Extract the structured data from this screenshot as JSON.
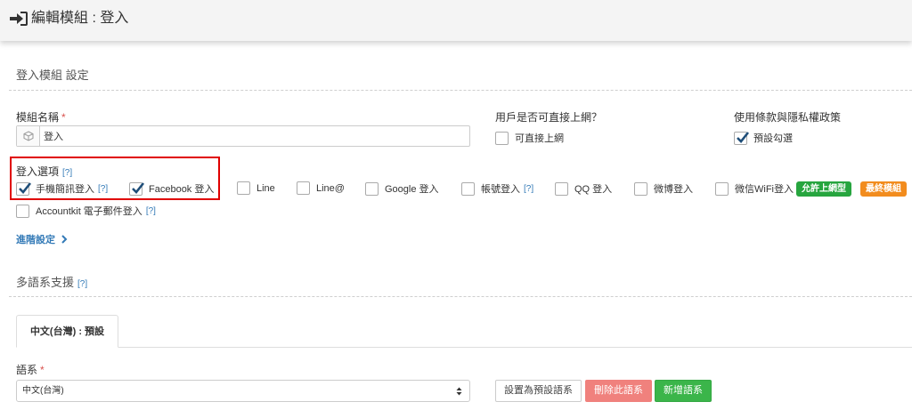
{
  "header": {
    "title": "編輯模組 : 登入",
    "icon": "sign-in-icon"
  },
  "settings": {
    "section_title": "登入模組 設定",
    "module_name": {
      "label": "模組名稱",
      "required": "*",
      "value": "登入",
      "icon": "cube-icon"
    },
    "direct_access": {
      "label": "用戶是否可直接上網？",
      "option": "可直接上網",
      "checked": false
    },
    "terms": {
      "label": "使用條款與隱私權政策",
      "option": "預設勾選",
      "checked": true
    },
    "login_options": {
      "label": "登入選項",
      "help": "[?]",
      "items": [
        {
          "label": "手機簡訊登入",
          "help": "[?]",
          "checked": true
        },
        {
          "label": "Facebook 登入",
          "checked": true
        },
        {
          "label": "Line",
          "checked": false
        },
        {
          "label": "Line@",
          "checked": false
        },
        {
          "label": "Google 登入",
          "checked": false
        },
        {
          "label": "帳號登入",
          "help": "[?]",
          "checked": false
        },
        {
          "label": "QQ 登入",
          "checked": false
        },
        {
          "label": "微博登入",
          "checked": false
        },
        {
          "label": "微信WiFi登入",
          "checked": false
        },
        {
          "label": "Accountkit 電子郵件登入",
          "help": "[?]",
          "checked": false
        }
      ],
      "tags": [
        {
          "label": "允許上網型",
          "color": "#27a53f"
        },
        {
          "label": "最終模組",
          "color": "#f28c1e"
        }
      ]
    },
    "advanced_link": "進階設定"
  },
  "language": {
    "section_title": "多語系支援",
    "help": "[?]",
    "tab": "中文(台灣) : 預設",
    "select_label": "語系",
    "required": "*",
    "selected": "中文(台灣)",
    "buttons": {
      "set_default": "設置為預設語系",
      "delete": "刪除此語系",
      "add": "新增語系"
    }
  }
}
